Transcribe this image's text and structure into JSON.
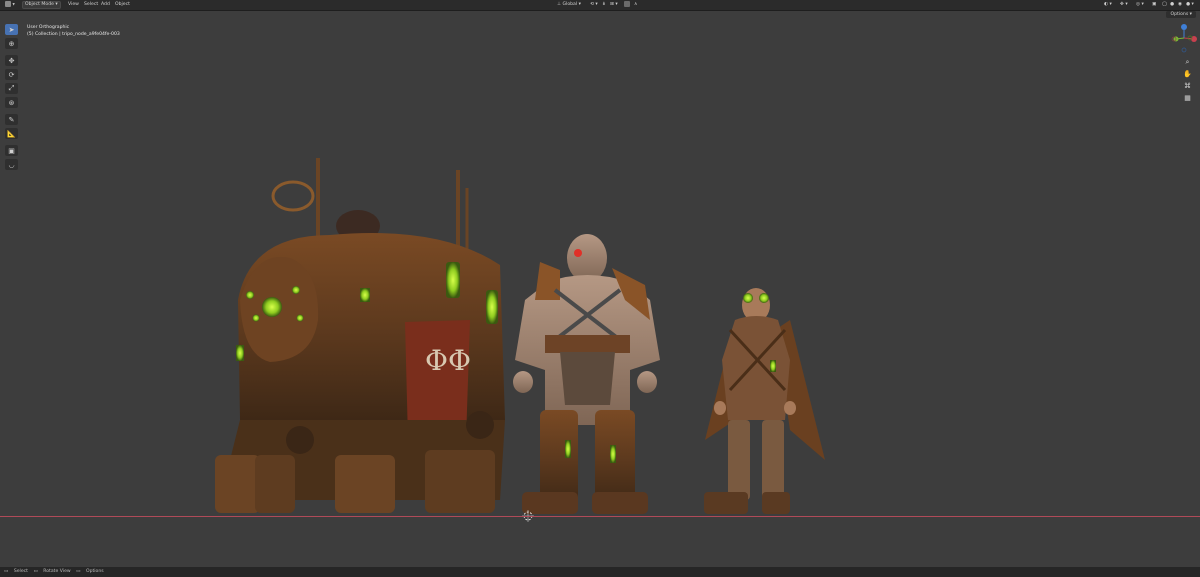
{
  "header": {
    "mode": "Object Mode",
    "menus": [
      "View",
      "Select",
      "Add",
      "Object"
    ],
    "transform_orientation": "Global",
    "options": "Options"
  },
  "viewport": {
    "view_name": "User Orthographic",
    "collection": "(5) Collection | tripo_node_a9fe04fe-003"
  },
  "status": {
    "items": [
      "Select",
      "Rotate View",
      "Options"
    ]
  },
  "colors": {
    "accent": "#4772b3",
    "floor_line": "#b04a58",
    "axis_x": "#c8404f",
    "axis_y": "#7ab833",
    "axis_z": "#3f7fd6"
  }
}
